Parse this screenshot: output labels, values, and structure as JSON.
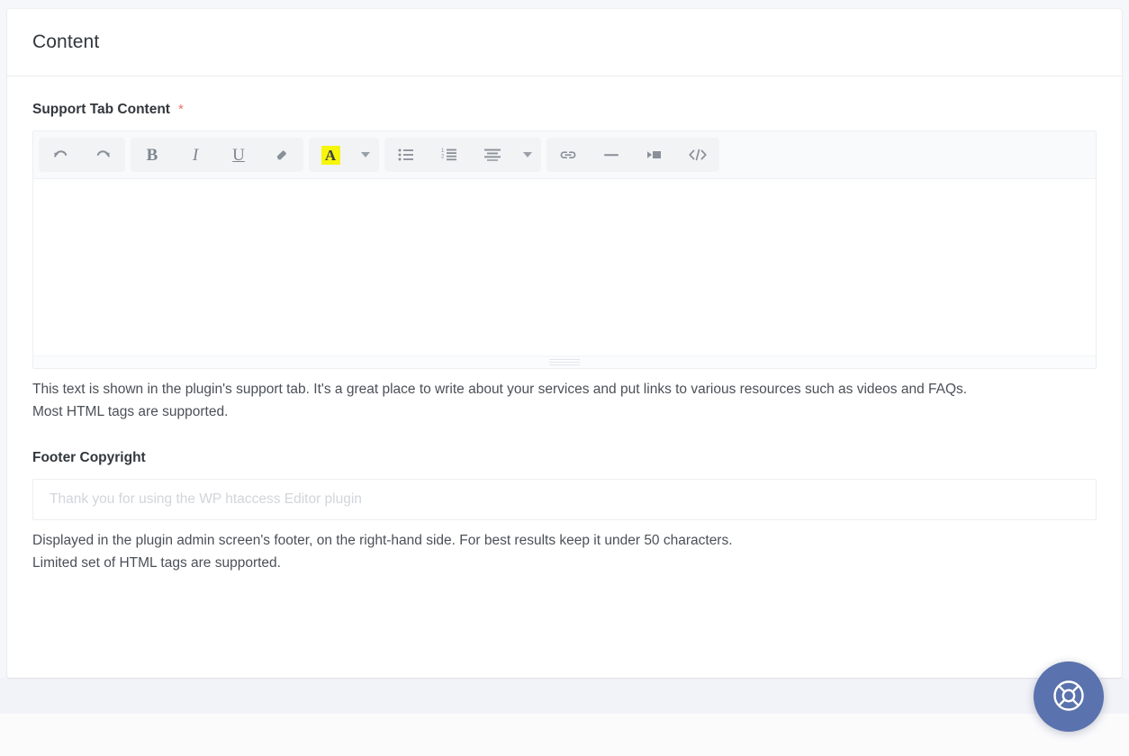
{
  "card": {
    "title": "Content"
  },
  "support_tab_field": {
    "label": "Support Tab Content",
    "required_mark": "*",
    "editor_value": "",
    "help_line_1": "This text is shown in the plugin's support tab. It's a great place to write about your services and put links to various resources such as videos and FAQs.",
    "help_line_2": "Most HTML tags are supported.",
    "toolbar": {
      "groups": [
        {
          "name": "history",
          "buttons": [
            {
              "icon": "undo-icon",
              "label": "Undo"
            },
            {
              "icon": "redo-icon",
              "label": "Redo"
            }
          ]
        },
        {
          "name": "formatting",
          "buttons": [
            {
              "icon": "bold-icon",
              "label": "Bold"
            },
            {
              "icon": "italic-icon",
              "label": "Italic"
            },
            {
              "icon": "underline-icon",
              "label": "Underline"
            },
            {
              "icon": "eraser-icon",
              "label": "Remove Format"
            }
          ]
        },
        {
          "name": "text-color",
          "buttons": [
            {
              "icon": "highlight-color-icon",
              "label": "A"
            },
            {
              "icon": "chevron-down-icon",
              "label": "Color options"
            }
          ]
        },
        {
          "name": "lists",
          "buttons": [
            {
              "icon": "bulleted-list-icon",
              "label": "Bulleted list"
            },
            {
              "icon": "numbered-list-icon",
              "label": "Numbered list"
            },
            {
              "icon": "align-icon",
              "label": "Alignment"
            },
            {
              "icon": "chevron-down-icon",
              "label": "Alignment options"
            }
          ]
        },
        {
          "name": "insert",
          "buttons": [
            {
              "icon": "link-icon",
              "label": "Insert link"
            },
            {
              "icon": "horizontal-rule-icon",
              "label": "Horizontal line"
            },
            {
              "icon": "video-icon",
              "label": "Insert media"
            },
            {
              "icon": "source-code-icon",
              "label": "Source code"
            }
          ]
        }
      ]
    }
  },
  "footer_copyright_field": {
    "label": "Footer Copyright",
    "value": "",
    "placeholder": "Thank you for using the WP htaccess Editor plugin",
    "help_line_1": "Displayed in the plugin admin screen's footer, on the right-hand side. For best results keep it under 50 characters.",
    "help_line_2": "Limited set of HTML tags are supported."
  },
  "support_fab": {
    "icon": "lifebuoy-icon",
    "label": "Support",
    "color": "#5a72ad"
  },
  "colors": {
    "page_background": "#f6f7fb",
    "card_background": "#ffffff",
    "required": "#e8736b",
    "highlight": "#f6f60a",
    "accent": "#5a72ad"
  }
}
